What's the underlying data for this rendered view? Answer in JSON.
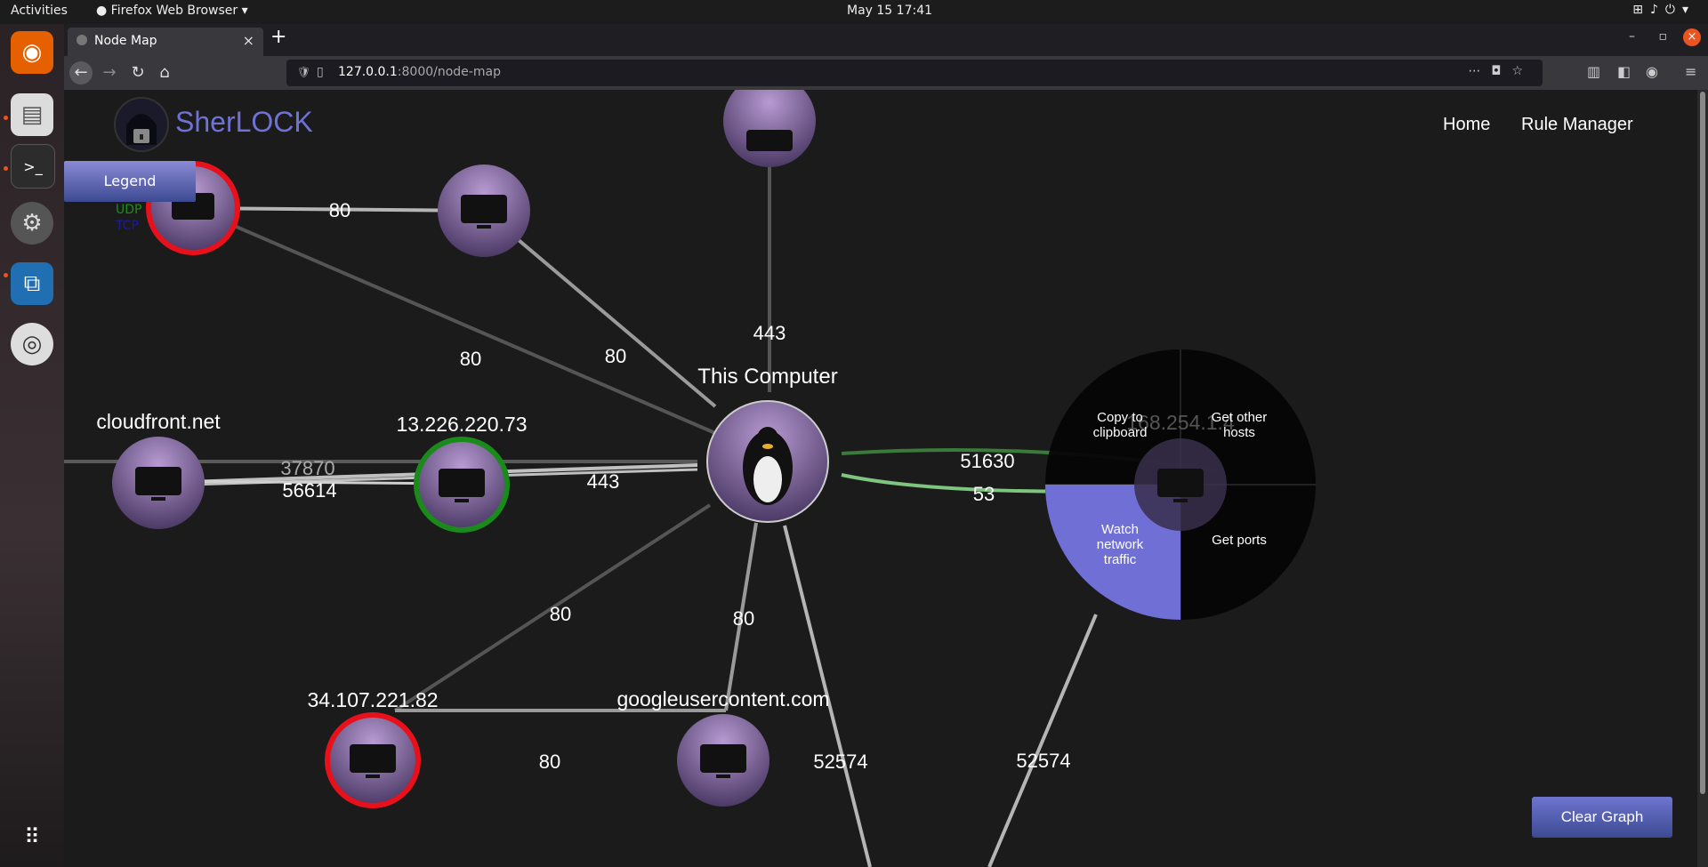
{
  "os": {
    "activities": "Activities",
    "app_name": "Firefox Web Browser",
    "clock": "May 15  17:41"
  },
  "browser": {
    "tab_title": "Node Map",
    "url_host": "127.0.0.1",
    "url_path": ":8000/node-map"
  },
  "app": {
    "brand": "SherLOCK",
    "nav": {
      "home": "Home",
      "rule_manager": "Rule Manager"
    },
    "legend": {
      "button": "Legend",
      "udp": "UDP",
      "tcp": "TCP",
      "udp_color": "#1f8a1f",
      "tcp_color": "#1a1aa8"
    },
    "clear_button": "Clear Graph"
  },
  "graph": {
    "center": "This Computer",
    "hosts": {
      "cloudfront": "cloudfront.net",
      "ip13": "13.226.220.73",
      "ip34": "34.107.221.82",
      "google": "googleusercontent.com",
      "partial": "168.254.1.4"
    },
    "edges": {
      "e80a": "80",
      "e80b": "80",
      "e80c": "80",
      "e443a": "443",
      "e37870": "37870",
      "e56614": "56614",
      "e443b": "443",
      "e51630": "51630",
      "e53": "53",
      "e80d": "80",
      "e80e": "80",
      "e80f": "80",
      "e52574a": "52574",
      "e52574b": "52574"
    },
    "context_menu": {
      "copy_l1": "Copy to",
      "copy_l2": "clipboard",
      "hosts_l1": "Get other",
      "hosts_l2": "hosts",
      "watch_l1": "Watch",
      "watch_l2": "network",
      "watch_l3": "traffic",
      "ports": "Get ports"
    },
    "colors": {
      "alert_ring": "#e8101a",
      "safe_ring": "#1a8a1a",
      "menu_active": "#6f6fd6"
    }
  }
}
